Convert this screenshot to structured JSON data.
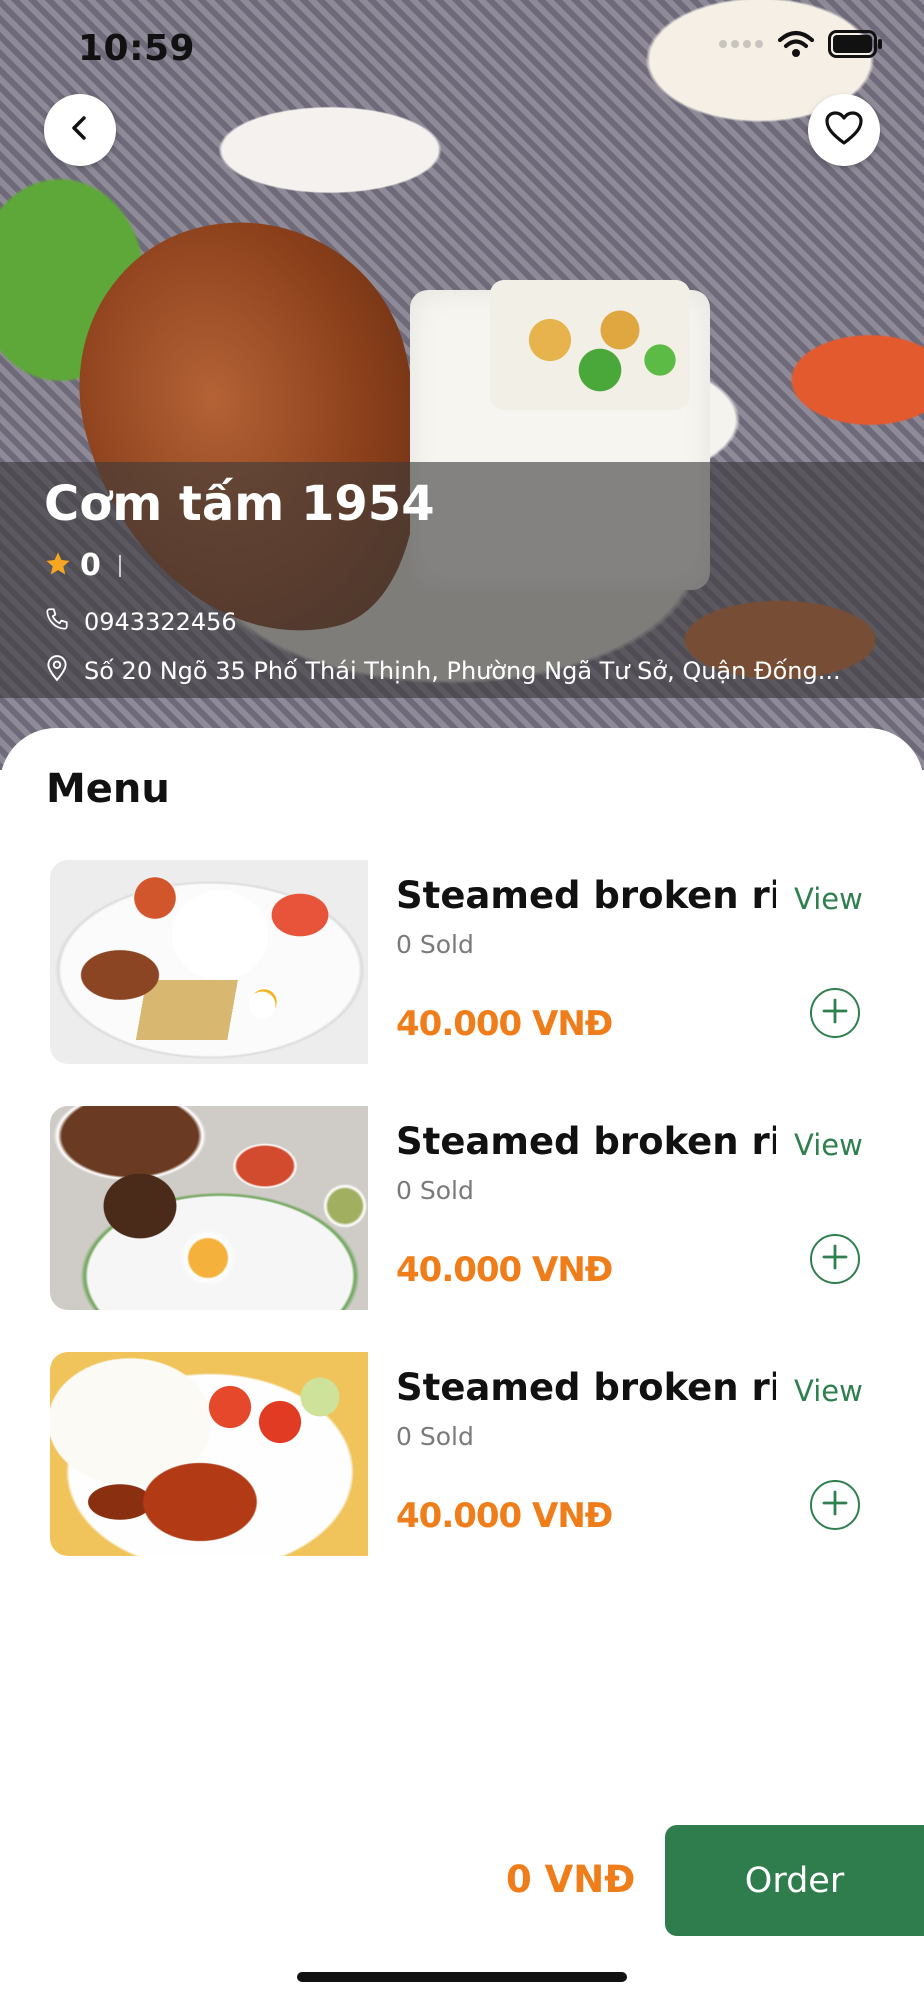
{
  "status_bar": {
    "time": "10:59"
  },
  "restaurant": {
    "name": "Cơm tấm 1954",
    "rating": "0",
    "phone": "0943322456",
    "address": "Số 20 Ngõ 35 Phố Thái Thịnh, Phường Ngã Tư Sở, Quận Đống..."
  },
  "menu": {
    "title": "Menu",
    "items": [
      {
        "name": "Steamed broken ric...",
        "sold": "0 Sold",
        "price": "40.000 VNĐ",
        "view_label": "View"
      },
      {
        "name": "Steamed broken ric...",
        "sold": "0 Sold",
        "price": "40.000 VNĐ",
        "view_label": "View"
      },
      {
        "name": "Steamed broken ric...",
        "sold": "0 Sold",
        "price": "40.000 VNĐ",
        "view_label": "View"
      }
    ]
  },
  "footer": {
    "total": "0 VNĐ",
    "order_label": "Order"
  },
  "colors": {
    "accent_green": "#2f7d4c",
    "price_orange": "#ef7d1a",
    "star": "#f5a623"
  },
  "icons": [
    "back-icon",
    "heart-icon",
    "star-icon",
    "phone-icon",
    "location-pin-icon",
    "plus-icon",
    "wifi-icon",
    "battery-icon",
    "signal-icon"
  ]
}
